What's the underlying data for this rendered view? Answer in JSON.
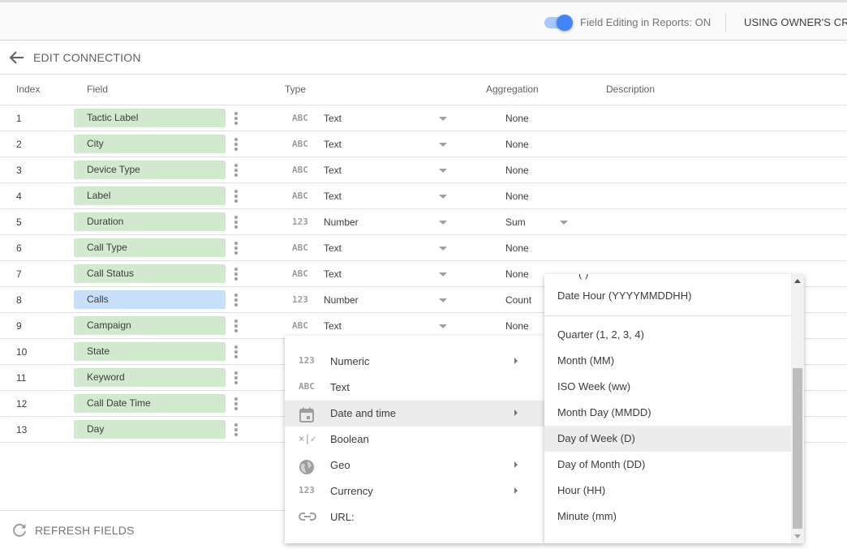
{
  "topbar": {
    "toggle_state": "on",
    "toggle_label": "Field Editing in Reports: ON",
    "credentials_label": "USING OWNER'S CREI"
  },
  "editbar": {
    "back_icon": "arrow-left-icon",
    "label": "EDIT CONNECTION"
  },
  "table": {
    "headers": {
      "index": "Index",
      "field": "Field",
      "type": "Type",
      "aggregation": "Aggregation",
      "description": "Description"
    },
    "rows": [
      {
        "index": "1",
        "field": "Tactic Label",
        "kind": "dimension",
        "type_icon": "ABC",
        "type": "Text",
        "aggregation": "None",
        "agg_dropdown": false
      },
      {
        "index": "2",
        "field": "City",
        "kind": "dimension",
        "type_icon": "ABC",
        "type": "Text",
        "aggregation": "None",
        "agg_dropdown": false
      },
      {
        "index": "3",
        "field": "Device Type",
        "kind": "dimension",
        "type_icon": "ABC",
        "type": "Text",
        "aggregation": "None",
        "agg_dropdown": false
      },
      {
        "index": "4",
        "field": "Label",
        "kind": "dimension",
        "type_icon": "ABC",
        "type": "Text",
        "aggregation": "None",
        "agg_dropdown": false
      },
      {
        "index": "5",
        "field": "Duration",
        "kind": "dimension",
        "type_icon": "123",
        "type": "Number",
        "aggregation": "Sum",
        "agg_dropdown": true
      },
      {
        "index": "6",
        "field": "Call Type",
        "kind": "dimension",
        "type_icon": "ABC",
        "type": "Text",
        "aggregation": "None",
        "agg_dropdown": false
      },
      {
        "index": "7",
        "field": "Call Status",
        "kind": "dimension",
        "type_icon": "ABC",
        "type": "Text",
        "aggregation": "None",
        "agg_dropdown": false
      },
      {
        "index": "8",
        "field": "Calls",
        "kind": "metric",
        "type_icon": "123",
        "type": "Number",
        "aggregation": "Count",
        "agg_dropdown": false
      },
      {
        "index": "9",
        "field": "Campaign",
        "kind": "dimension",
        "type_icon": "ABC",
        "type": "Text",
        "aggregation": "None",
        "agg_dropdown": false
      },
      {
        "index": "10",
        "field": "State",
        "kind": "dimension",
        "type_icon": "",
        "type": "",
        "aggregation": "",
        "agg_dropdown": false
      },
      {
        "index": "11",
        "field": "Keyword",
        "kind": "dimension",
        "type_icon": "",
        "type": "",
        "aggregation": "",
        "agg_dropdown": false
      },
      {
        "index": "12",
        "field": "Call Date Time",
        "kind": "dimension",
        "type_icon": "",
        "type": "",
        "aggregation": "",
        "agg_dropdown": false
      },
      {
        "index": "13",
        "field": "Day",
        "kind": "dimension",
        "type_icon": "",
        "type": "",
        "aggregation": "",
        "agg_dropdown": false
      }
    ]
  },
  "type_menu": {
    "items": [
      {
        "icon": "123",
        "icon_name": "numeric-icon",
        "label": "Numeric",
        "submenu": true,
        "active": false
      },
      {
        "icon": "ABC",
        "icon_name": "text-icon",
        "label": "Text",
        "submenu": false,
        "active": false
      },
      {
        "icon": "",
        "icon_name": "calendar-icon",
        "label": "Date and time",
        "submenu": true,
        "active": true
      },
      {
        "icon": "×|✓",
        "icon_name": "boolean-icon",
        "label": "Boolean",
        "submenu": false,
        "active": false
      },
      {
        "icon": "",
        "icon_name": "globe-icon",
        "label": "Geo",
        "submenu": true,
        "active": false
      },
      {
        "icon": "123",
        "icon_name": "currency-icon",
        "label": "Currency",
        "submenu": true,
        "active": false
      },
      {
        "icon": "",
        "icon_name": "link-icon",
        "label": "URL:",
        "submenu": false,
        "active": false
      }
    ]
  },
  "date_submenu": {
    "partial_item": "(          )",
    "items": [
      {
        "label": "Date Hour (YYYYMMDDHH)",
        "active": false
      },
      {
        "label": "Quarter (1, 2, 3, 4)",
        "active": false
      },
      {
        "label": "Month (MM)",
        "active": false
      },
      {
        "label": "ISO Week (ww)",
        "active": false
      },
      {
        "label": "Month Day (MMDD)",
        "active": false
      },
      {
        "label": "Day of Week (D)",
        "active": true
      },
      {
        "label": "Day of Month (DD)",
        "active": false
      },
      {
        "label": "Hour (HH)",
        "active": false
      },
      {
        "label": "Minute (mm)",
        "active": false
      }
    ]
  },
  "footer": {
    "refresh_label": "REFRESH FIELDS"
  },
  "colors": {
    "dimension_field": "#d3e9cf",
    "metric_field": "#c6e0fa",
    "toggle_on": "#4285f4",
    "menu_active": "#ececec"
  }
}
